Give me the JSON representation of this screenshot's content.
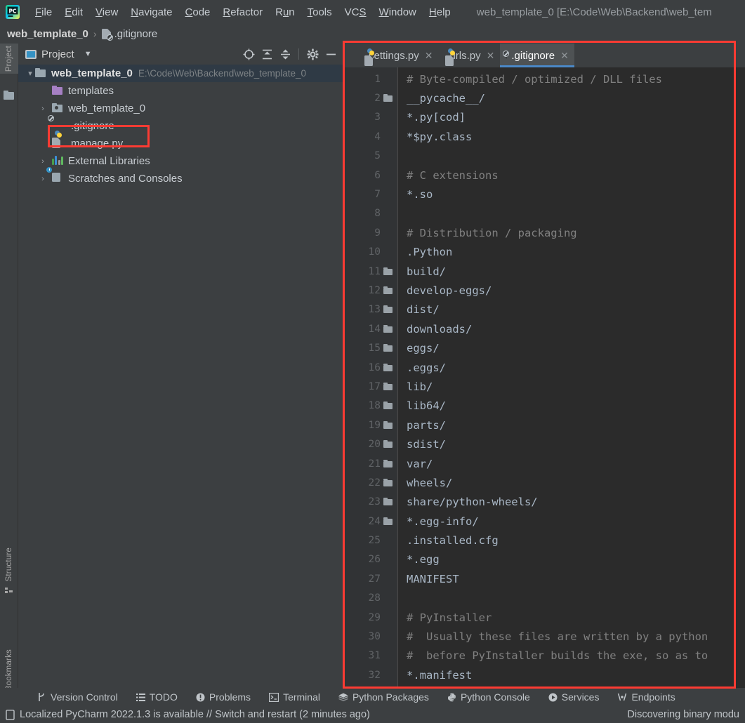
{
  "window": {
    "app_icon": "pycharm-logo-icon",
    "title": "web_template_0 [E:\\Code\\Web\\Backend\\web_tem"
  },
  "menubar": {
    "items": [
      {
        "label": "File",
        "mnemonic": "F"
      },
      {
        "label": "Edit",
        "mnemonic": "E"
      },
      {
        "label": "View",
        "mnemonic": "V"
      },
      {
        "label": "Navigate",
        "mnemonic": "N"
      },
      {
        "label": "Code",
        "mnemonic": "C"
      },
      {
        "label": "Refactor",
        "mnemonic": "R"
      },
      {
        "label": "Run",
        "mnemonic": "u"
      },
      {
        "label": "Tools",
        "mnemonic": "T"
      },
      {
        "label": "VCS",
        "mnemonic": "S"
      },
      {
        "label": "Window",
        "mnemonic": "W"
      },
      {
        "label": "Help",
        "mnemonic": "H"
      }
    ]
  },
  "breadcrumb": {
    "root": "web_template_0",
    "separator": "›",
    "file": ".gitignore",
    "file_icon": "gitignore-file-icon"
  },
  "left_rail": {
    "items": [
      {
        "label": "Project",
        "active": true,
        "icon": "folder-icon"
      },
      {
        "label": "Structure",
        "active": false,
        "icon": "structure-icon"
      },
      {
        "label": "Bookmarks",
        "active": false,
        "icon": "bookmark-icon"
      }
    ]
  },
  "project_panel": {
    "title": "Project",
    "title_icon": "project-view-icon",
    "dropdown_icon": "chevron-down-icon",
    "tools": [
      {
        "name": "select-opened-file-icon",
        "label": "Select Opened File"
      },
      {
        "name": "expand-all-icon",
        "label": "Expand All"
      },
      {
        "name": "collapse-all-icon",
        "label": "Collapse All"
      },
      {
        "name": "settings-gear-icon",
        "label": "Settings"
      },
      {
        "name": "hide-panel-icon",
        "label": "Hide"
      }
    ],
    "tree": [
      {
        "label": "web_template_0",
        "path": "E:\\Code\\Web\\Backend\\web_template_0",
        "icon": "project-root-folder-icon",
        "arrow": "⌄",
        "expanded": true,
        "selected": true,
        "indent": 0,
        "bold": true
      },
      {
        "label": "templates",
        "path": "",
        "icon": "templates-folder-icon",
        "arrow": "",
        "expanded": false,
        "selected": false,
        "indent": 1,
        "bold": false
      },
      {
        "label": "web_template_0",
        "path": "",
        "icon": "python-package-folder-icon",
        "arrow": "›",
        "expanded": false,
        "selected": false,
        "indent": 1,
        "bold": false
      },
      {
        "label": ".gitignore",
        "path": "",
        "icon": "gitignore-file-icon",
        "arrow": "",
        "expanded": false,
        "selected": false,
        "indent": 1,
        "bold": false,
        "highlighted": true
      },
      {
        "label": "manage.py",
        "path": "",
        "icon": "python-file-icon",
        "arrow": "",
        "expanded": false,
        "selected": false,
        "indent": 1,
        "bold": false
      },
      {
        "label": "External Libraries",
        "path": "",
        "icon": "external-libraries-icon",
        "arrow": "›",
        "expanded": false,
        "selected": false,
        "indent": 0,
        "bold": false
      },
      {
        "label": "Scratches and Consoles",
        "path": "",
        "icon": "scratches-consoles-icon",
        "arrow": "›",
        "expanded": false,
        "selected": false,
        "indent": 0,
        "bold": false
      }
    ]
  },
  "editor": {
    "tabs": [
      {
        "label": "settings.py",
        "icon": "python-file-icon",
        "active": false,
        "close_icon": "close-icon"
      },
      {
        "label": "urls.py",
        "icon": "python-file-icon",
        "active": false,
        "close_icon": "close-icon"
      },
      {
        "label": ".gitignore",
        "icon": "gitignore-file-icon",
        "active": true,
        "close_icon": "close-icon"
      }
    ],
    "active_file": ".gitignore",
    "lines": [
      {
        "n": 1,
        "text": "# Byte-compiled / optimized / DLL files",
        "comment": true,
        "folder": false
      },
      {
        "n": 2,
        "text": "__pycache__/",
        "comment": false,
        "folder": true
      },
      {
        "n": 3,
        "text": "*.py[cod]",
        "comment": false,
        "folder": false
      },
      {
        "n": 4,
        "text": "*$py.class",
        "comment": false,
        "folder": false
      },
      {
        "n": 5,
        "text": "",
        "comment": false,
        "folder": false
      },
      {
        "n": 6,
        "text": "# C extensions",
        "comment": true,
        "folder": false
      },
      {
        "n": 7,
        "text": "*.so",
        "comment": false,
        "folder": false
      },
      {
        "n": 8,
        "text": "",
        "comment": false,
        "folder": false
      },
      {
        "n": 9,
        "text": "# Distribution / packaging",
        "comment": true,
        "folder": false
      },
      {
        "n": 10,
        "text": ".Python",
        "comment": false,
        "folder": false
      },
      {
        "n": 11,
        "text": "build/",
        "comment": false,
        "folder": true
      },
      {
        "n": 12,
        "text": "develop-eggs/",
        "comment": false,
        "folder": true
      },
      {
        "n": 13,
        "text": "dist/",
        "comment": false,
        "folder": true
      },
      {
        "n": 14,
        "text": "downloads/",
        "comment": false,
        "folder": true
      },
      {
        "n": 15,
        "text": "eggs/",
        "comment": false,
        "folder": true
      },
      {
        "n": 16,
        "text": ".eggs/",
        "comment": false,
        "folder": true
      },
      {
        "n": 17,
        "text": "lib/",
        "comment": false,
        "folder": true
      },
      {
        "n": 18,
        "text": "lib64/",
        "comment": false,
        "folder": true
      },
      {
        "n": 19,
        "text": "parts/",
        "comment": false,
        "folder": true
      },
      {
        "n": 20,
        "text": "sdist/",
        "comment": false,
        "folder": true
      },
      {
        "n": 21,
        "text": "var/",
        "comment": false,
        "folder": true
      },
      {
        "n": 22,
        "text": "wheels/",
        "comment": false,
        "folder": true
      },
      {
        "n": 23,
        "text": "share/python-wheels/",
        "comment": false,
        "folder": true
      },
      {
        "n": 24,
        "text": "*.egg-info/",
        "comment": false,
        "folder": true
      },
      {
        "n": 25,
        "text": ".installed.cfg",
        "comment": false,
        "folder": false
      },
      {
        "n": 26,
        "text": "*.egg",
        "comment": false,
        "folder": false
      },
      {
        "n": 27,
        "text": "MANIFEST",
        "comment": false,
        "folder": false
      },
      {
        "n": 28,
        "text": "",
        "comment": false,
        "folder": false
      },
      {
        "n": 29,
        "text": "# PyInstaller",
        "comment": true,
        "folder": false
      },
      {
        "n": 30,
        "text": "#  Usually these files are written by a python",
        "comment": true,
        "folder": false
      },
      {
        "n": 31,
        "text": "#  before PyInstaller builds the exe, so as to",
        "comment": true,
        "folder": false
      },
      {
        "n": 32,
        "text": "*.manifest",
        "comment": false,
        "folder": false
      }
    ]
  },
  "bottom_toolwindows": {
    "items": [
      {
        "label": "Version Control",
        "icon": "branch-icon"
      },
      {
        "label": "TODO",
        "icon": "list-icon"
      },
      {
        "label": "Problems",
        "icon": "warning-icon"
      },
      {
        "label": "Terminal",
        "icon": "terminal-icon"
      },
      {
        "label": "Python Packages",
        "icon": "layers-icon"
      },
      {
        "label": "Python Console",
        "icon": "python-icon"
      },
      {
        "label": "Services",
        "icon": "play-circle-icon"
      },
      {
        "label": "Endpoints",
        "icon": "endpoints-icon"
      }
    ]
  },
  "status_bar": {
    "icon": "notification-icon",
    "message": "Localized PyCharm 2022.1.3 is available // Switch and restart (2 minutes ago)",
    "right_message": "Discovering binary modu"
  },
  "annotations": [
    {
      "name": "editor-region-highlight",
      "color": "#fc3b33"
    },
    {
      "name": "gitignore-tree-item-highlight",
      "color": "#fc3b33"
    }
  ],
  "colors": {
    "chrome_bg": "#3c3f41",
    "editor_bg": "#2b2b2b",
    "gutter_bg": "#313335",
    "selection_bg": "#2f3a45",
    "tab_active_bg": "#4e5254",
    "tab_underline": "#4a88c7",
    "text": "#c8cdd2",
    "code_text": "#a9b7c6",
    "comment_text": "#808080",
    "line_number": "#606366",
    "annotation_red": "#fc3b33"
  }
}
